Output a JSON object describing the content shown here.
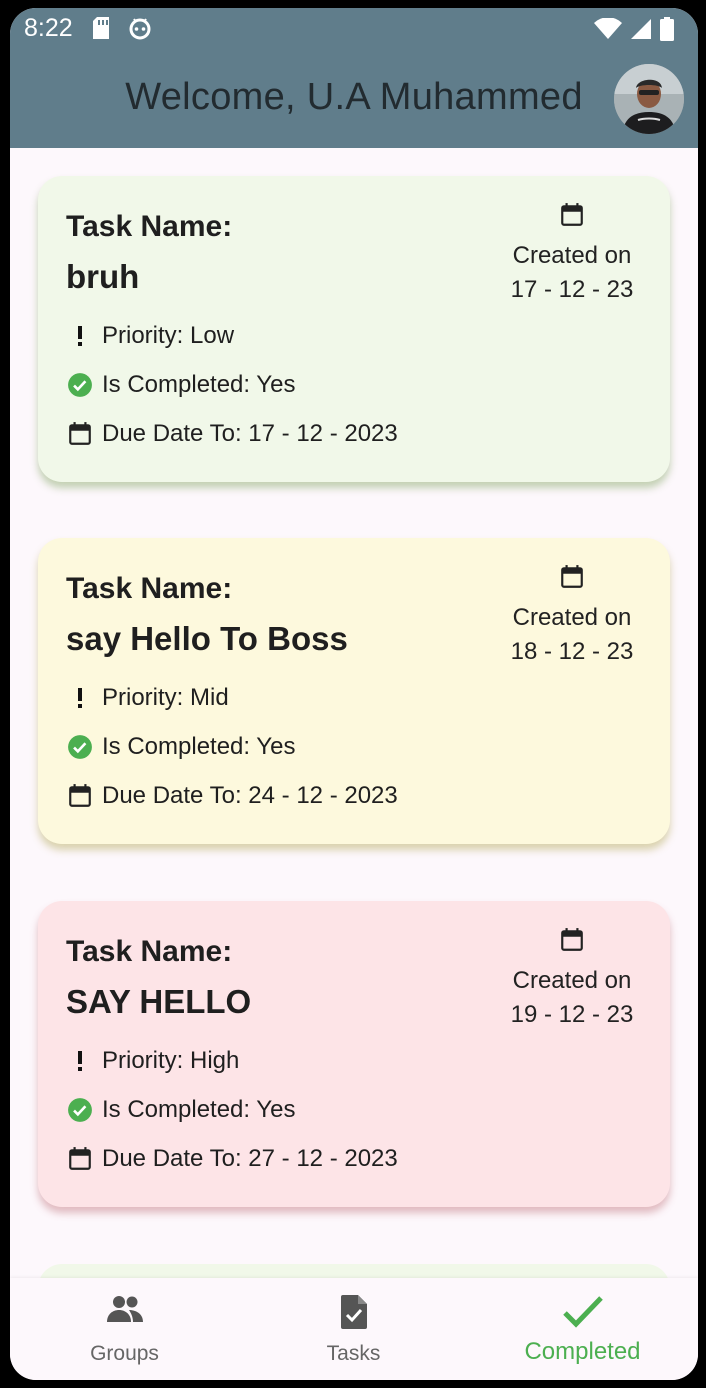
{
  "status_bar": {
    "time": "8:22"
  },
  "header": {
    "welcome_text": "Welcome, U.A Muhammed"
  },
  "tasks": [
    {
      "task_label": "Task Name:",
      "name": "bruh",
      "created_label": "Created on",
      "created_date": "17 - 12 - 23",
      "priority": "Priority: Low",
      "completed": "Is Completed: Yes",
      "due": "Due Date To: 17 - 12 - 2023",
      "color": "#f1f8e9"
    },
    {
      "task_label": "Task Name:",
      "name": "say Hello To Boss",
      "created_label": "Created on",
      "created_date": "18 - 12 - 23",
      "priority": "Priority: Mid",
      "completed": "Is Completed: Yes",
      "due": "Due Date To: 24 - 12 - 2023",
      "color": "#fdf9dd"
    },
    {
      "task_label": "Task Name:",
      "name": "SAY HELLO",
      "created_label": "Created on",
      "created_date": "19 - 12 - 23",
      "priority": "Priority: High",
      "completed": "Is Completed: Yes",
      "due": "Due Date To: 27 - 12 - 2023",
      "color": "#fde4e7"
    }
  ],
  "bottom_nav": {
    "items": [
      {
        "label": "Groups",
        "icon": "groups-icon"
      },
      {
        "label": "Tasks",
        "icon": "task-file-icon"
      },
      {
        "label": "Completed",
        "icon": "check-icon",
        "active": true
      }
    ],
    "active_color": "#4caf50"
  },
  "colors": {
    "app_bar": "#607d8b",
    "check_green": "#4caf50"
  }
}
